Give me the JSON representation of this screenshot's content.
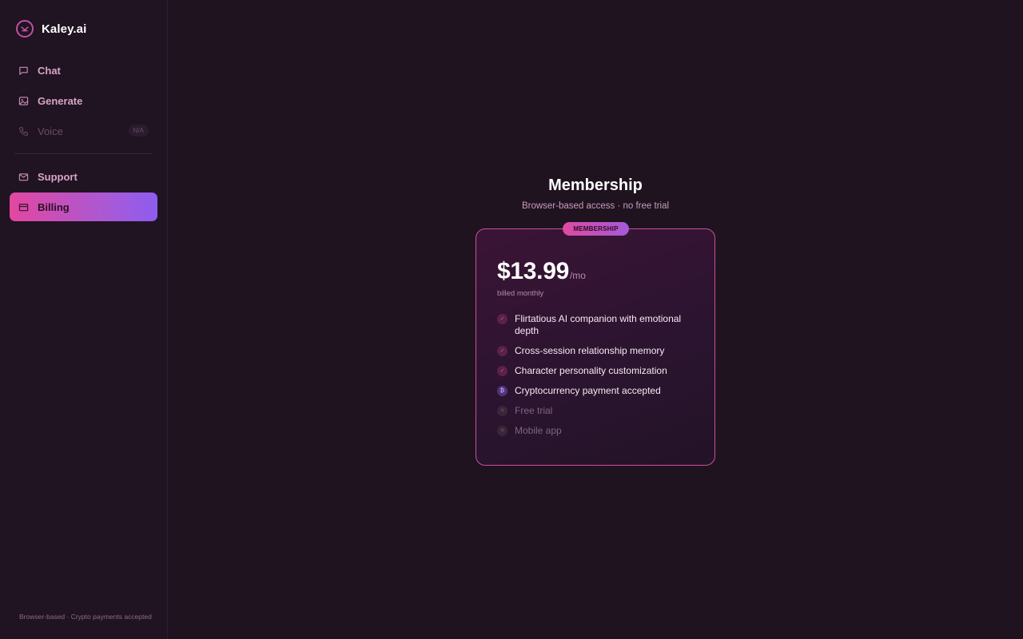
{
  "brand": {
    "name": "Kaley.ai"
  },
  "sidebar": {
    "items": [
      {
        "label": "Chat",
        "icon": "chat-icon"
      },
      {
        "label": "Generate",
        "icon": "image-icon"
      },
      {
        "label": "Voice",
        "icon": "phone-icon",
        "badge": "N/A",
        "disabled": true
      },
      {
        "label": "Support",
        "icon": "mail-icon"
      },
      {
        "label": "Billing",
        "icon": "card-icon",
        "active": true
      }
    ],
    "footer": "Browser-based · Crypto payments accepted"
  },
  "main": {
    "title": "Membership",
    "subtitle": "Browser-based access · no free trial",
    "plan": {
      "badge": "MEMBERSHIP",
      "price": "$13.99",
      "period": "/mo",
      "billing_note": "billed monthly",
      "features": [
        {
          "text": "Flirtatious AI companion with emotional depth",
          "status": "included"
        },
        {
          "text": "Cross-session relationship memory",
          "status": "included"
        },
        {
          "text": "Character personality customization",
          "status": "included"
        },
        {
          "text": "Cryptocurrency payment accepted",
          "status": "crypto"
        },
        {
          "text": "Free trial",
          "status": "excluded"
        },
        {
          "text": "Mobile app",
          "status": "excluded"
        }
      ]
    }
  },
  "colors": {
    "background": "#1f1320",
    "accent_pink": "#e2479f",
    "accent_purple": "#8d5cf0",
    "card_border": "#cf4f96"
  }
}
